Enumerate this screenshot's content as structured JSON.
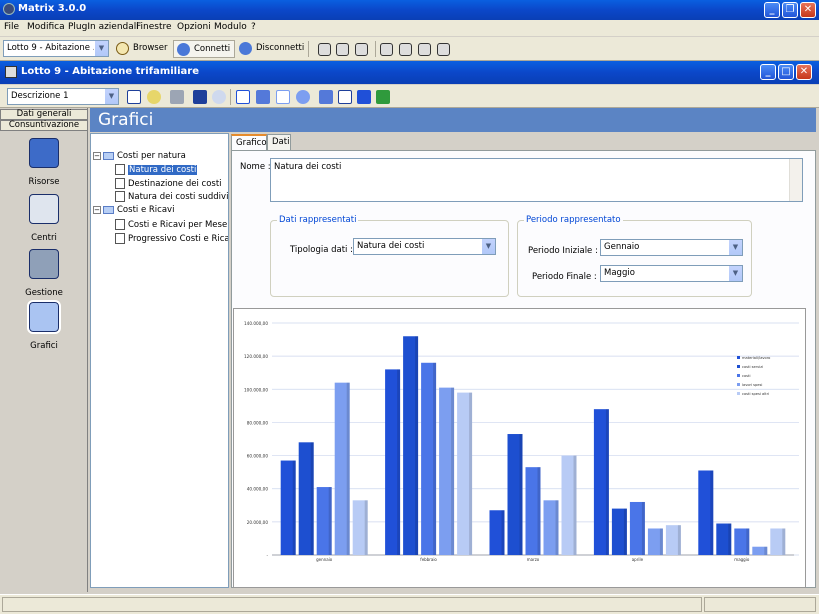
{
  "app": {
    "title": "Matrix 3.0.0"
  },
  "menu": [
    "File",
    "Modifica",
    "PlugIn aziendali",
    "Finestre",
    "Opzioni",
    "Modulo",
    "?"
  ],
  "toolbar": {
    "lotto_value": "Lotto 9 - Abitazione ...",
    "browser_label": "Browser",
    "connetti_label": "Connetti",
    "disconnetti_label": "Disconnetti"
  },
  "inner_window": {
    "title": "Lotto 9 - Abitazione trifamiliare"
  },
  "toolbar2": {
    "descrizione_value": "Descrizione 1"
  },
  "sidebar": {
    "btn_dati_generali": "Dati generali",
    "btn_consuntivazione": "Consuntivazione",
    "items": [
      {
        "label": "Risorse"
      },
      {
        "label": "Centri"
      },
      {
        "label": "Gestione"
      },
      {
        "label": "Grafici"
      }
    ]
  },
  "header": {
    "title": "Grafici"
  },
  "tree": {
    "folders": [
      {
        "label": "Costi per natura",
        "children": [
          "Natura dei costi",
          "Destinazione dei costi",
          "Natura dei costi suddivisi"
        ]
      },
      {
        "label": "Costi e Ricavi",
        "children": [
          "Costi e Ricavi per Mese",
          "Progressivo Costi e Ricav"
        ]
      }
    ]
  },
  "tabs": [
    "Grafico",
    "Dati"
  ],
  "form": {
    "nome_label": "Nome :",
    "nome_value": "Natura dei costi",
    "group1_title": "Dati rappresentati",
    "tipologia_label": "Tipologia dati :",
    "tipologia_value": "Natura dei costi",
    "group2_title": "Periodo rappresentato",
    "periodo_iniziale_label": "Periodo Iniziale :",
    "periodo_iniziale_value": "Gennaio",
    "periodo_finale_label": "Periodo Finale :",
    "periodo_finale_value": "Maggio"
  },
  "chart_data": {
    "type": "bar",
    "categories": [
      "gennaio",
      "febbraio",
      "marzo",
      "aprile",
      "maggio"
    ],
    "ylim": [
      0,
      140000
    ],
    "yticks": [
      "-",
      "20.000,00",
      "40.000,00",
      "60.000,00",
      "80.000,00",
      "100.000,00",
      "120.000,00",
      "140.000,00"
    ],
    "series": [
      {
        "name": "materiali/lavoro",
        "color": "#2050d8",
        "values": [
          57000,
          112000,
          27000,
          88000,
          51000
        ]
      },
      {
        "name": "costi servizi",
        "color": "#1d4fd0",
        "values": [
          68000,
          132000,
          73000,
          28000,
          19000
        ]
      },
      {
        "name": "costi",
        "color": "#4a75e8",
        "values": [
          41000,
          116000,
          53000,
          32000,
          16000
        ]
      },
      {
        "name": "lavori spesi",
        "color": "#7c9ef0",
        "values": [
          104000,
          101000,
          33000,
          16000,
          5000
        ]
      },
      {
        "name": "costi spesi altri",
        "color": "#b8cbf5",
        "values": [
          33000,
          98000,
          60000,
          18000,
          16000
        ]
      }
    ],
    "legend": "right",
    "grid": true
  },
  "colors": {
    "accent": "#0b47c9",
    "header": "#5b84c4"
  }
}
